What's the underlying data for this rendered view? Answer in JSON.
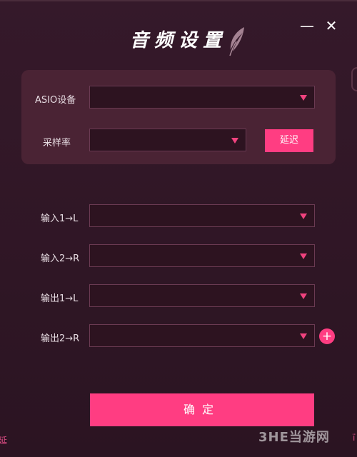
{
  "window": {
    "title": "音频设置",
    "minimize_label": "—",
    "close_label": "✕"
  },
  "asio": {
    "label": "ASIO设备",
    "value": ""
  },
  "sample_rate": {
    "label": "采样率",
    "value": "",
    "delay_button": "延迟"
  },
  "channels": [
    {
      "label": "输入1→L",
      "value": ""
    },
    {
      "label": "输入2→R",
      "value": ""
    },
    {
      "label": "输出1→L",
      "value": ""
    },
    {
      "label": "输出2→R",
      "value": ""
    }
  ],
  "add_button": "+",
  "confirm_button": "确定",
  "edge_texts": {
    "left": "延",
    "right": "ï"
  },
  "watermark": "3HE当游网",
  "colors": {
    "accent": "#ff3d82",
    "background": "#2f1625",
    "panel": "#4a2334"
  },
  "icons": {
    "dropdown": "chevron-down-icon",
    "feather": "feather-icon",
    "add": "plus-icon"
  }
}
